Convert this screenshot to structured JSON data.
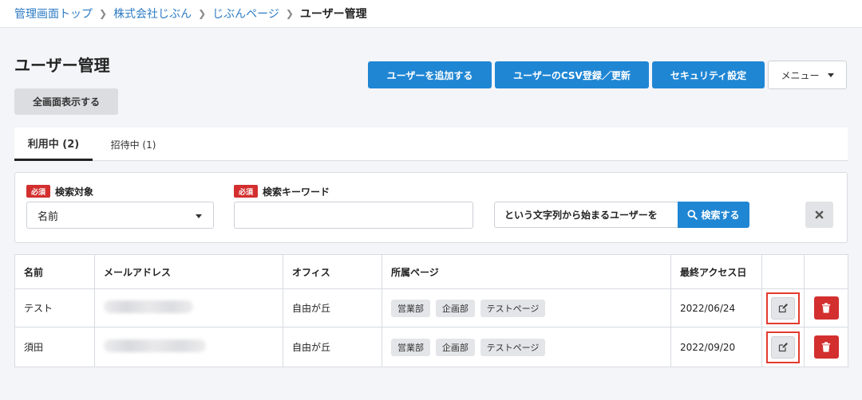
{
  "breadcrumb": {
    "items": [
      "管理画面トップ",
      "株式会社じぶん",
      "じぶんページ"
    ],
    "current": "ユーザー管理"
  },
  "page": {
    "title": "ユーザー管理"
  },
  "toolbar": {
    "fullscreen_label": "全画面表示する",
    "add_user_label": "ユーザーを追加する",
    "csv_label": "ユーザーのCSV登録／更新",
    "security_label": "セキュリティ設定",
    "menu_label": "メニュー"
  },
  "tabs": [
    {
      "label": "利用中 (2)",
      "active": true
    },
    {
      "label": "招待中 (1)",
      "active": false
    }
  ],
  "search": {
    "required_badge": "必須",
    "target_label": "検索対象",
    "target_value": "名前",
    "keyword_label": "検索キーワード",
    "keyword_value": "",
    "match_mode": "という文字列から始まるユーザーを",
    "search_label": "検索する"
  },
  "table": {
    "headers": [
      "名前",
      "メールアドレス",
      "オフィス",
      "所属ページ",
      "最終アクセス日",
      "",
      ""
    ],
    "rows": [
      {
        "name": "テスト",
        "office": "自由が丘",
        "pages": [
          "営業部",
          "企画部",
          "テストページ"
        ],
        "last_access": "2022/06/24"
      },
      {
        "name": "須田",
        "office": "自由が丘",
        "pages": [
          "営業部",
          "企画部",
          "テストページ"
        ],
        "last_access": "2022/09/20"
      }
    ]
  },
  "colors": {
    "primary": "#1f86d4",
    "danger": "#d32f2f",
    "highlight": "#e33b2e",
    "link": "#2d7bc4"
  }
}
